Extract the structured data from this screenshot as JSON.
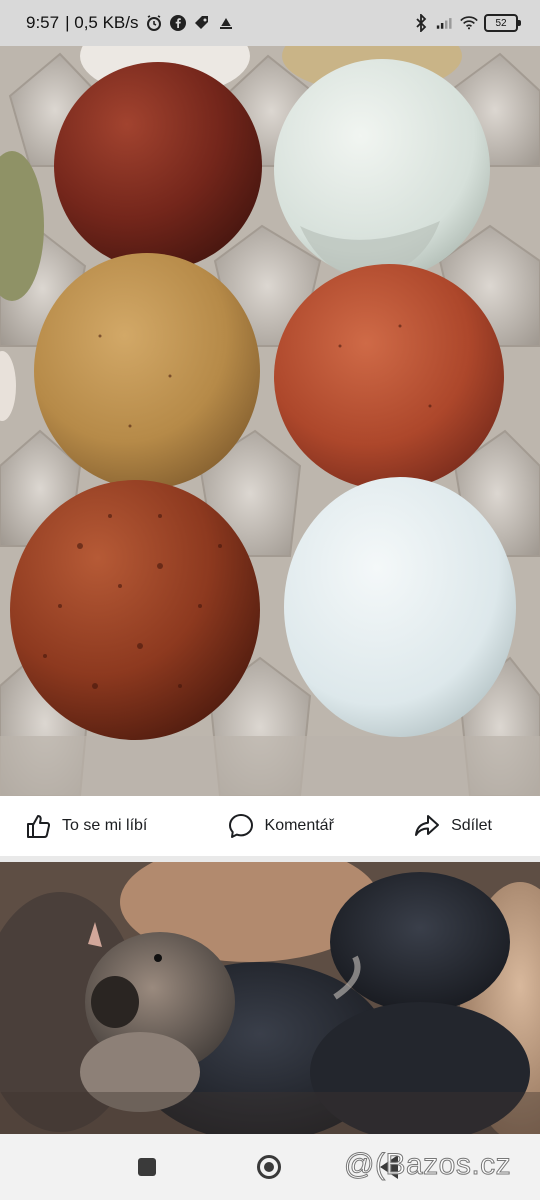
{
  "status_bar": {
    "time": "9:57",
    "network_speed": "| 0,5 KB/s",
    "battery_level": "52",
    "icons": [
      "alarm-icon",
      "facebook-icon",
      "tag-icon",
      "signal-icon",
      "bluetooth-icon",
      "cell-signal-icon",
      "wifi-icon",
      "battery-icon"
    ]
  },
  "photo_main": {
    "subject": "eggs-in-carton",
    "egg_colors": [
      "#7a2a1e",
      "#dfe7e2",
      "#b98c4e",
      "#b04a2c",
      "#8e3a22",
      "#dfe9ec"
    ]
  },
  "post_actions": {
    "like_label": "To se mi líbí",
    "comment_label": "Komentář",
    "share_label": "Sdílet"
  },
  "photo_secondary": {
    "subject": "chicks"
  },
  "nav_bar": {
    "watermark": "@(Bazos.cz"
  }
}
